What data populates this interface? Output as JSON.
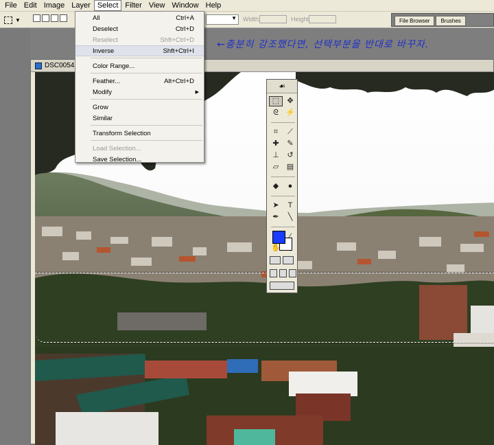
{
  "menubar": {
    "items": [
      "File",
      "Edit",
      "Image",
      "Layer",
      "Select",
      "Filter",
      "View",
      "Window",
      "Help"
    ],
    "active": "Select"
  },
  "options_bar": {
    "width_label": "Width:",
    "height_label": "Height:",
    "palette_tabs": [
      "File Browser",
      "Brushes"
    ]
  },
  "annotation": "←충분히 강조했다면, 선택부분을 반대로 바꾸자.",
  "document": {
    "title": "DSC00545..."
  },
  "select_menu": {
    "items": [
      {
        "label": "All",
        "shortcut": "Ctrl+A",
        "enabled": true
      },
      {
        "label": "Deselect",
        "shortcut": "Ctrl+D",
        "enabled": true
      },
      {
        "label": "Reselect",
        "shortcut": "Shft+Ctrl+D",
        "enabled": false
      },
      {
        "label": "Inverse",
        "shortcut": "Shft+Ctrl+I",
        "enabled": true,
        "highlighted": true
      },
      {
        "separator": true
      },
      {
        "label": "Color Range...",
        "shortcut": "",
        "enabled": true
      },
      {
        "separator": true
      },
      {
        "label": "Feather...",
        "shortcut": "Alt+Ctrl+D",
        "enabled": true
      },
      {
        "label": "Modify",
        "shortcut": "",
        "enabled": true,
        "submenu": true
      },
      {
        "separator": true
      },
      {
        "label": "Grow",
        "shortcut": "",
        "enabled": true
      },
      {
        "label": "Similar",
        "shortcut": "",
        "enabled": true
      },
      {
        "separator": true
      },
      {
        "label": "Transform Selection",
        "shortcut": "",
        "enabled": true
      },
      {
        "separator": true
      },
      {
        "label": "Load Selection...",
        "shortcut": "",
        "enabled": false
      },
      {
        "label": "Save Selection...",
        "shortcut": "",
        "enabled": true
      }
    ]
  },
  "tools": {
    "foreground_color": "#1a3cff",
    "background_color": "#ffffff",
    "icons": [
      "rect-marquee",
      "move",
      "lasso",
      "magic-wand",
      "crop",
      "slice",
      "healing-brush",
      "brush",
      "clone-stamp",
      "history-brush",
      "eraser",
      "gradient",
      "blur",
      "dodge",
      "path-select",
      "type",
      "pen",
      "line",
      "notes",
      "eyedropper",
      "hand",
      "zoom"
    ]
  },
  "colors": {
    "accent": "#2030c8",
    "menu_highlight": "#dfe2ea"
  }
}
